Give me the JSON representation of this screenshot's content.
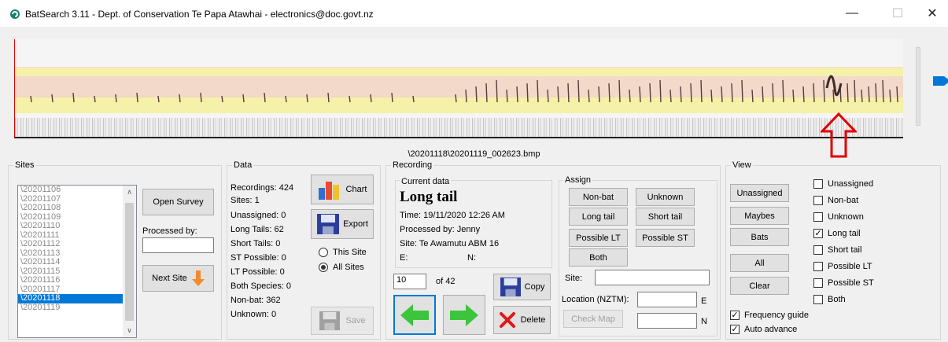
{
  "window": {
    "title": "BatSearch 3.11 - Dept. of Conservation Te Papa Atawhai - electronics@doc.govt.nz",
    "minimize": "—",
    "maximize": "☐",
    "close": "✕"
  },
  "spectrogram": {
    "filename": "\\20201118\\20201119_002623.bmp",
    "band_colors": {
      "orange": "#f3d9c9",
      "yellow": "#f5f1a8"
    },
    "annotation_arrow_color": "#e00000"
  },
  "sites": {
    "legend": "Sites",
    "items": [
      "\\20201106",
      "\\20201107",
      "\\20201108",
      "\\20201109",
      "\\20201110",
      "\\20201111",
      "\\20201112",
      "\\20201113",
      "\\20201114",
      "\\20201115",
      "\\20201116",
      "\\20201117",
      "\\20201118",
      "\\20201119"
    ],
    "selected_index": 12,
    "open_survey": "Open Survey",
    "processed_by_label": "Processed by:",
    "processed_by_value": "",
    "next_site": "Next Site"
  },
  "data": {
    "legend": "Data",
    "stats": [
      "Recordings: 424",
      "Sites: 1",
      "Unassigned: 0",
      "Long Tails: 62",
      "Short Tails: 0",
      "ST Possible: 0",
      "LT Possible: 0",
      "Both Species: 0",
      "Non-bat: 362",
      "Unknown: 0"
    ],
    "chart": "Chart",
    "export": "Export",
    "this_site": "This Site",
    "all_sites": "All Sites",
    "save": "Save"
  },
  "recording": {
    "legend": "Recording",
    "current_legend": "Current data",
    "species": "Long tail",
    "time": "Time: 19/11/2020  12:26 AM",
    "processed_by": "Processed by: Jenny",
    "site": "Site: Te Awamutu ABM 16",
    "e_label": "E:",
    "n_label": "N:",
    "index_value": "10",
    "of_total": "of 42",
    "copy": "Copy",
    "delete": "Delete"
  },
  "assign": {
    "legend": "Assign",
    "buttons": {
      "non_bat": "Non-bat",
      "unknown": "Unknown",
      "long_tail": "Long tail",
      "short_tail": "Short tail",
      "possible_lt": "Possible LT",
      "possible_st": "Possible ST",
      "both": "Both"
    },
    "site_label": "Site:",
    "site_value": "",
    "location_label": "Location (NZTM):",
    "e_suffix": "E",
    "n_suffix": "N",
    "check_map": "Check Map"
  },
  "view": {
    "legend": "View",
    "buttons": [
      "Unassigned",
      "Maybes",
      "Bats",
      "All",
      "Clear"
    ],
    "filters": [
      {
        "label": "Unassigned",
        "checked": false
      },
      {
        "label": "Non-bat",
        "checked": false
      },
      {
        "label": "Unknown",
        "checked": false
      },
      {
        "label": "Long tail",
        "checked": true
      },
      {
        "label": "Short tail",
        "checked": false
      },
      {
        "label": "Possible LT",
        "checked": false
      },
      {
        "label": "Possible ST",
        "checked": false
      },
      {
        "label": "Both",
        "checked": false
      }
    ],
    "frequency_guide": {
      "label": "Frequency guide",
      "checked": true
    },
    "auto_advance": {
      "label": "Auto advance",
      "checked": true
    }
  },
  "colors": {
    "selection": "#0078d7",
    "nav_arrow": "#3cc43c",
    "next_site_arrow": "#f28a2e"
  }
}
